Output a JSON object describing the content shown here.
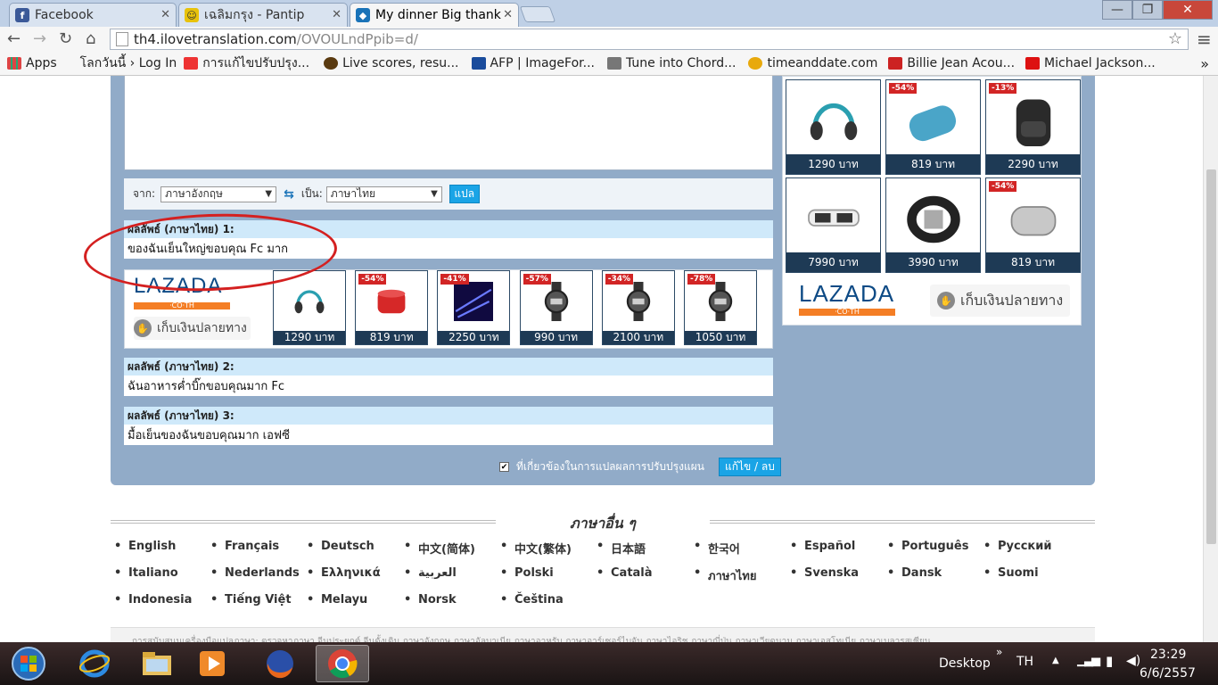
{
  "browser": {
    "tabs": [
      {
        "title": "Facebook",
        "favicon_color": "#3b5998",
        "favicon_glyph": "f"
      },
      {
        "title": "เฉลิมกรุง - Pantip",
        "favicon_color": "#e8c20a",
        "favicon_glyph": "☺"
      },
      {
        "title": "My dinner Big thank",
        "favicon_color": "#1a73b8",
        "favicon_glyph": "◆"
      }
    ],
    "window_controls": {
      "minimize": "—",
      "maximize": "❐",
      "close": "✕"
    },
    "address": {
      "host": "th4.ilovetranslation.com",
      "path": "/OVOULndPpib=d/"
    },
    "nav_icons": {
      "back": "←",
      "forward": "→",
      "reload": "↻",
      "home": "⌂",
      "star": "☆",
      "menu": "≡"
    },
    "bookmarks": [
      {
        "label": "Apps",
        "color": "#d44"
      },
      {
        "label": "โลกวันนี้ › Log In",
        "color": ""
      },
      {
        "label": "การแก้ไขปรับปรุง...",
        "color": "#e33"
      },
      {
        "label": "Live scores, resu...",
        "color": "#5a3a10"
      },
      {
        "label": "AFP | ImageFor...",
        "color": "#1a4c9c"
      },
      {
        "label": "Tune into Chord...",
        "color": "#777"
      },
      {
        "label": "timeanddate.com",
        "color": "#e8a90c"
      },
      {
        "label": "Billie Jean Acou...",
        "color": "#c22"
      },
      {
        "label": "Michael Jackson...",
        "color": "#d11"
      }
    ],
    "bookmarks_more": "»"
  },
  "translator": {
    "from_label": "จาก:",
    "from_value": "ภาษาอังกฤษ",
    "swap_icon": "⇆",
    "to_label": "เป็น:",
    "to_value": "ภาษาไทย",
    "translate_button": "แปล",
    "results": [
      {
        "heading": "ผลลัพธ์ (ภาษาไทย) 1:",
        "text": "ของฉันเย็นใหญ่ขอบคุณ Fc มาก"
      },
      {
        "heading": "ผลลัพธ์ (ภาษาไทย) 2:",
        "text": "ฉันอาหารค่ำบิ๊กขอบคุณมาก Fc"
      },
      {
        "heading": "ผลลัพธ์ (ภาษาไทย) 3:",
        "text": "มื้อเย็นของฉันขอบคุณมาก เอฟซี"
      }
    ],
    "feedback_text": "ที่เกี่ยวข้องในการแปลผลการปรับปรุงแผน",
    "edit_button": "แก้ไข / ลบ",
    "feedback_checked": "✔"
  },
  "ads": {
    "logo": "LAZADA",
    "logo_sub": "·CO·TH",
    "cod_label": "เก็บเงินปลายทาง",
    "currency": "บาท",
    "inline_products": [
      {
        "price": "1290 บาท",
        "discount": "",
        "kind": "headphones"
      },
      {
        "price": "819 บาท",
        "discount": "-54%",
        "kind": "speaker-red"
      },
      {
        "price": "2250 บาท",
        "discount": "-41%",
        "kind": "laser"
      },
      {
        "price": "990 บาท",
        "discount": "-57%",
        "kind": "watch"
      },
      {
        "price": "2100 บาท",
        "discount": "-34%",
        "kind": "watch"
      },
      {
        "price": "1050 บาท",
        "discount": "-78%",
        "kind": "watch"
      }
    ],
    "sidebar_products": [
      {
        "price": "1290 บาท",
        "discount": "",
        "kind": "headphones"
      },
      {
        "price": "819 บาท",
        "discount": "-54%",
        "kind": "speaker-blue"
      },
      {
        "price": "2290 บาท",
        "discount": "-13%",
        "kind": "backpack"
      },
      {
        "price": "7990 บาท",
        "discount": "",
        "kind": "glasses"
      },
      {
        "price": "3990 บาท",
        "discount": "",
        "kind": "band"
      },
      {
        "price": "819 บาท",
        "discount": "-54%",
        "kind": "speaker-silver"
      }
    ]
  },
  "other_languages": {
    "title": "ภาษาอื่น ๆ",
    "items": [
      "English",
      "Français",
      "Deutsch",
      "中文(简体)",
      "中文(繁体)",
      "日本語",
      "한국어",
      "Español",
      "Português",
      "Русский",
      "Italiano",
      "Nederlands",
      "Ελληνικά",
      "العربية",
      "Polski",
      "Català",
      "ภาษาไทย",
      "Svenska",
      "Dansk",
      "Suomi",
      "Indonesia",
      "Tiếng Việt",
      "Melayu",
      "Norsk",
      "Čeština"
    ]
  },
  "footer_text": "การสนับสนุนเครื่องมือแปลภาษา: ตรวจหาภาษา จีนประยุกต์ จีนดั้งเดิม ภาษาอังกฤษ ภาษาอัลบาเนีย ภาษาอาหรับ ภาษาอาร์เซอร์ไบจัน ภาษาไอริช ภาษาญี่ปุ่น ภาษาเวียดนาม ภาษาเอสโทเนีย ภาษาเบลารุสเซียน",
  "taskbar": {
    "desktop_label": "Desktop",
    "chevron": "»",
    "lang": "TH",
    "time": "23:29",
    "date": "6/6/2557"
  },
  "colors": {
    "panel": "#91abc8",
    "result_head": "#cfe9fa",
    "accent_button": "#1aa4e6",
    "price_bar": "#1e3a55",
    "discount": "#d22525",
    "annotation": "#d42020"
  }
}
